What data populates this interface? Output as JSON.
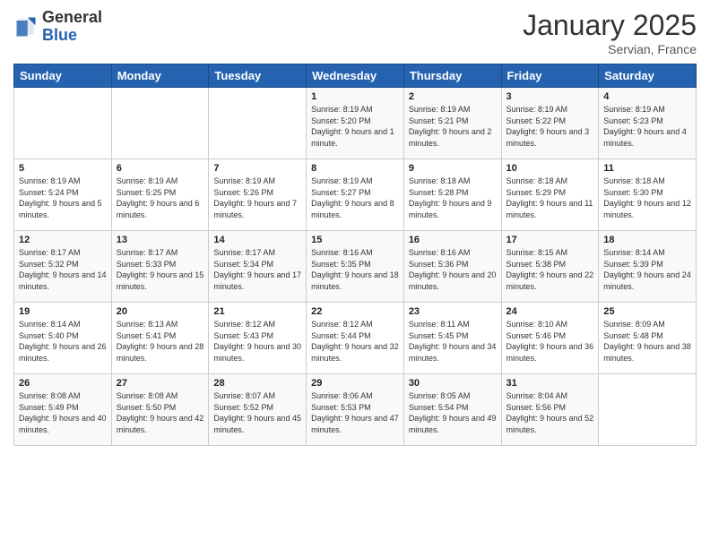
{
  "header": {
    "logo_general": "General",
    "logo_blue": "Blue",
    "month_title": "January 2025",
    "location": "Servian, France"
  },
  "weekdays": [
    "Sunday",
    "Monday",
    "Tuesday",
    "Wednesday",
    "Thursday",
    "Friday",
    "Saturday"
  ],
  "weeks": [
    [
      {
        "day": "",
        "sunrise": "",
        "sunset": "",
        "daylight": ""
      },
      {
        "day": "",
        "sunrise": "",
        "sunset": "",
        "daylight": ""
      },
      {
        "day": "",
        "sunrise": "",
        "sunset": "",
        "daylight": ""
      },
      {
        "day": "1",
        "sunrise": "Sunrise: 8:19 AM",
        "sunset": "Sunset: 5:20 PM",
        "daylight": "Daylight: 9 hours and 1 minute."
      },
      {
        "day": "2",
        "sunrise": "Sunrise: 8:19 AM",
        "sunset": "Sunset: 5:21 PM",
        "daylight": "Daylight: 9 hours and 2 minutes."
      },
      {
        "day": "3",
        "sunrise": "Sunrise: 8:19 AM",
        "sunset": "Sunset: 5:22 PM",
        "daylight": "Daylight: 9 hours and 3 minutes."
      },
      {
        "day": "4",
        "sunrise": "Sunrise: 8:19 AM",
        "sunset": "Sunset: 5:23 PM",
        "daylight": "Daylight: 9 hours and 4 minutes."
      }
    ],
    [
      {
        "day": "5",
        "sunrise": "Sunrise: 8:19 AM",
        "sunset": "Sunset: 5:24 PM",
        "daylight": "Daylight: 9 hours and 5 minutes."
      },
      {
        "day": "6",
        "sunrise": "Sunrise: 8:19 AM",
        "sunset": "Sunset: 5:25 PM",
        "daylight": "Daylight: 9 hours and 6 minutes."
      },
      {
        "day": "7",
        "sunrise": "Sunrise: 8:19 AM",
        "sunset": "Sunset: 5:26 PM",
        "daylight": "Daylight: 9 hours and 7 minutes."
      },
      {
        "day": "8",
        "sunrise": "Sunrise: 8:19 AM",
        "sunset": "Sunset: 5:27 PM",
        "daylight": "Daylight: 9 hours and 8 minutes."
      },
      {
        "day": "9",
        "sunrise": "Sunrise: 8:18 AM",
        "sunset": "Sunset: 5:28 PM",
        "daylight": "Daylight: 9 hours and 9 minutes."
      },
      {
        "day": "10",
        "sunrise": "Sunrise: 8:18 AM",
        "sunset": "Sunset: 5:29 PM",
        "daylight": "Daylight: 9 hours and 11 minutes."
      },
      {
        "day": "11",
        "sunrise": "Sunrise: 8:18 AM",
        "sunset": "Sunset: 5:30 PM",
        "daylight": "Daylight: 9 hours and 12 minutes."
      }
    ],
    [
      {
        "day": "12",
        "sunrise": "Sunrise: 8:17 AM",
        "sunset": "Sunset: 5:32 PM",
        "daylight": "Daylight: 9 hours and 14 minutes."
      },
      {
        "day": "13",
        "sunrise": "Sunrise: 8:17 AM",
        "sunset": "Sunset: 5:33 PM",
        "daylight": "Daylight: 9 hours and 15 minutes."
      },
      {
        "day": "14",
        "sunrise": "Sunrise: 8:17 AM",
        "sunset": "Sunset: 5:34 PM",
        "daylight": "Daylight: 9 hours and 17 minutes."
      },
      {
        "day": "15",
        "sunrise": "Sunrise: 8:16 AM",
        "sunset": "Sunset: 5:35 PM",
        "daylight": "Daylight: 9 hours and 18 minutes."
      },
      {
        "day": "16",
        "sunrise": "Sunrise: 8:16 AM",
        "sunset": "Sunset: 5:36 PM",
        "daylight": "Daylight: 9 hours and 20 minutes."
      },
      {
        "day": "17",
        "sunrise": "Sunrise: 8:15 AM",
        "sunset": "Sunset: 5:38 PM",
        "daylight": "Daylight: 9 hours and 22 minutes."
      },
      {
        "day": "18",
        "sunrise": "Sunrise: 8:14 AM",
        "sunset": "Sunset: 5:39 PM",
        "daylight": "Daylight: 9 hours and 24 minutes."
      }
    ],
    [
      {
        "day": "19",
        "sunrise": "Sunrise: 8:14 AM",
        "sunset": "Sunset: 5:40 PM",
        "daylight": "Daylight: 9 hours and 26 minutes."
      },
      {
        "day": "20",
        "sunrise": "Sunrise: 8:13 AM",
        "sunset": "Sunset: 5:41 PM",
        "daylight": "Daylight: 9 hours and 28 minutes."
      },
      {
        "day": "21",
        "sunrise": "Sunrise: 8:12 AM",
        "sunset": "Sunset: 5:43 PM",
        "daylight": "Daylight: 9 hours and 30 minutes."
      },
      {
        "day": "22",
        "sunrise": "Sunrise: 8:12 AM",
        "sunset": "Sunset: 5:44 PM",
        "daylight": "Daylight: 9 hours and 32 minutes."
      },
      {
        "day": "23",
        "sunrise": "Sunrise: 8:11 AM",
        "sunset": "Sunset: 5:45 PM",
        "daylight": "Daylight: 9 hours and 34 minutes."
      },
      {
        "day": "24",
        "sunrise": "Sunrise: 8:10 AM",
        "sunset": "Sunset: 5:46 PM",
        "daylight": "Daylight: 9 hours and 36 minutes."
      },
      {
        "day": "25",
        "sunrise": "Sunrise: 8:09 AM",
        "sunset": "Sunset: 5:48 PM",
        "daylight": "Daylight: 9 hours and 38 minutes."
      }
    ],
    [
      {
        "day": "26",
        "sunrise": "Sunrise: 8:08 AM",
        "sunset": "Sunset: 5:49 PM",
        "daylight": "Daylight: 9 hours and 40 minutes."
      },
      {
        "day": "27",
        "sunrise": "Sunrise: 8:08 AM",
        "sunset": "Sunset: 5:50 PM",
        "daylight": "Daylight: 9 hours and 42 minutes."
      },
      {
        "day": "28",
        "sunrise": "Sunrise: 8:07 AM",
        "sunset": "Sunset: 5:52 PM",
        "daylight": "Daylight: 9 hours and 45 minutes."
      },
      {
        "day": "29",
        "sunrise": "Sunrise: 8:06 AM",
        "sunset": "Sunset: 5:53 PM",
        "daylight": "Daylight: 9 hours and 47 minutes."
      },
      {
        "day": "30",
        "sunrise": "Sunrise: 8:05 AM",
        "sunset": "Sunset: 5:54 PM",
        "daylight": "Daylight: 9 hours and 49 minutes."
      },
      {
        "day": "31",
        "sunrise": "Sunrise: 8:04 AM",
        "sunset": "Sunset: 5:56 PM",
        "daylight": "Daylight: 9 hours and 52 minutes."
      },
      {
        "day": "",
        "sunrise": "",
        "sunset": "",
        "daylight": ""
      }
    ]
  ]
}
